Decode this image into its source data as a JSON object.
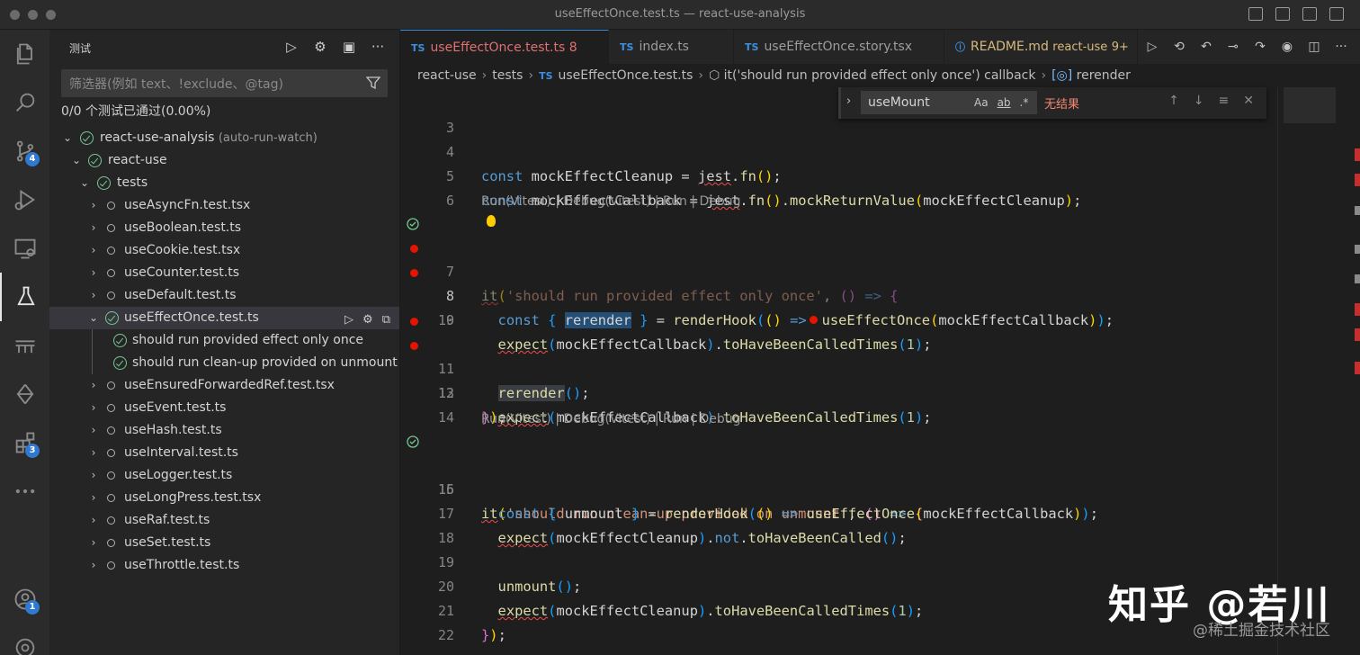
{
  "window": {
    "title": "useEffectOnce.test.ts — react-use-analysis"
  },
  "activity_bar": {
    "items": [
      {
        "name": "explorer-icon"
      },
      {
        "name": "search-icon"
      },
      {
        "name": "source-control-icon",
        "badge": "4"
      },
      {
        "name": "run-debug-icon"
      },
      {
        "name": "remote-explorer-icon"
      },
      {
        "name": "testing-icon",
        "active": true
      },
      {
        "name": "bridge-icon"
      },
      {
        "name": "timeline-icon"
      },
      {
        "name": "extensions-icon",
        "badge": "3"
      },
      {
        "name": "more-icon"
      }
    ],
    "account_badge": "1"
  },
  "sidebar": {
    "header": "测试",
    "filter_placeholder": "筛选器(例如 text、!exclude、@tag)",
    "summary": "0/0 个测试已通过(0.00%)",
    "tree": [
      {
        "label": "react-use-analysis",
        "suffix": "(auto-run-watch)",
        "state": "passed",
        "level": 0,
        "expanded": true
      },
      {
        "label": "react-use",
        "state": "passed",
        "level": 1,
        "expanded": true
      },
      {
        "label": "tests",
        "state": "passed",
        "level": 2,
        "expanded": true
      },
      {
        "label": "useAsyncFn.test.tsx",
        "state": "idle",
        "level": 3
      },
      {
        "label": "useBoolean.test.ts",
        "state": "idle",
        "level": 3
      },
      {
        "label": "useCookie.test.tsx",
        "state": "idle",
        "level": 3
      },
      {
        "label": "useCounter.test.ts",
        "state": "idle",
        "level": 3
      },
      {
        "label": "useDefault.test.ts",
        "state": "idle",
        "level": 3
      },
      {
        "label": "useEffectOnce.test.ts",
        "state": "passed",
        "level": 3,
        "expanded": true,
        "selected": true
      },
      {
        "label": "should run provided effect only once",
        "state": "passed",
        "level": 4
      },
      {
        "label": "should run clean-up provided on unmount",
        "state": "passed",
        "level": 4
      },
      {
        "label": "useEnsuredForwardedRef.test.tsx",
        "state": "idle",
        "level": 3
      },
      {
        "label": "useEvent.test.ts",
        "state": "idle",
        "level": 3
      },
      {
        "label": "useHash.test.ts",
        "state": "idle",
        "level": 3
      },
      {
        "label": "useInterval.test.ts",
        "state": "idle",
        "level": 3
      },
      {
        "label": "useLogger.test.ts",
        "state": "idle",
        "level": 3
      },
      {
        "label": "useLongPress.test.tsx",
        "state": "idle",
        "level": 3
      },
      {
        "label": "useRaf.test.ts",
        "state": "idle",
        "level": 3
      },
      {
        "label": "useSet.test.ts",
        "state": "idle",
        "level": 3
      },
      {
        "label": "useThrottle.test.ts",
        "state": "idle",
        "level": 3
      }
    ]
  },
  "tabs": [
    {
      "label": "useEffectOnce.test.ts",
      "badge": "8",
      "active": true
    },
    {
      "label": "index.ts"
    },
    {
      "label": "useEffectOnce.story.tsx"
    },
    {
      "label": "README.md",
      "extra": "react-use",
      "badge": "9+"
    }
  ],
  "breadcrumb": [
    "react-use",
    "tests",
    "useEffectOnce.test.ts",
    "it('should run provided effect only once') callback",
    "rerender"
  ],
  "find": {
    "value": "useMount",
    "opt_case": "Aa",
    "opt_word": "ab",
    "opt_regex": ".*",
    "result": "无结果"
  },
  "editor": {
    "codelens": "Run(Vitest) | Debug(Vitest) | Run | Debug",
    "line_numbers": [
      "3",
      "4",
      "5",
      "6",
      "7",
      "8",
      "9",
      "10",
      "11",
      "12",
      "13",
      "14",
      "15",
      "16",
      "17",
      "18",
      "19",
      "20",
      "21",
      "22"
    ]
  },
  "watermark": {
    "main": "知乎 @若川",
    "sub": "@稀土掘金技术社区"
  },
  "colors": {
    "accent": "#3d8fe0",
    "passed": "#73c991",
    "breakpoint": "#e51400",
    "error_text": "#f48771"
  }
}
